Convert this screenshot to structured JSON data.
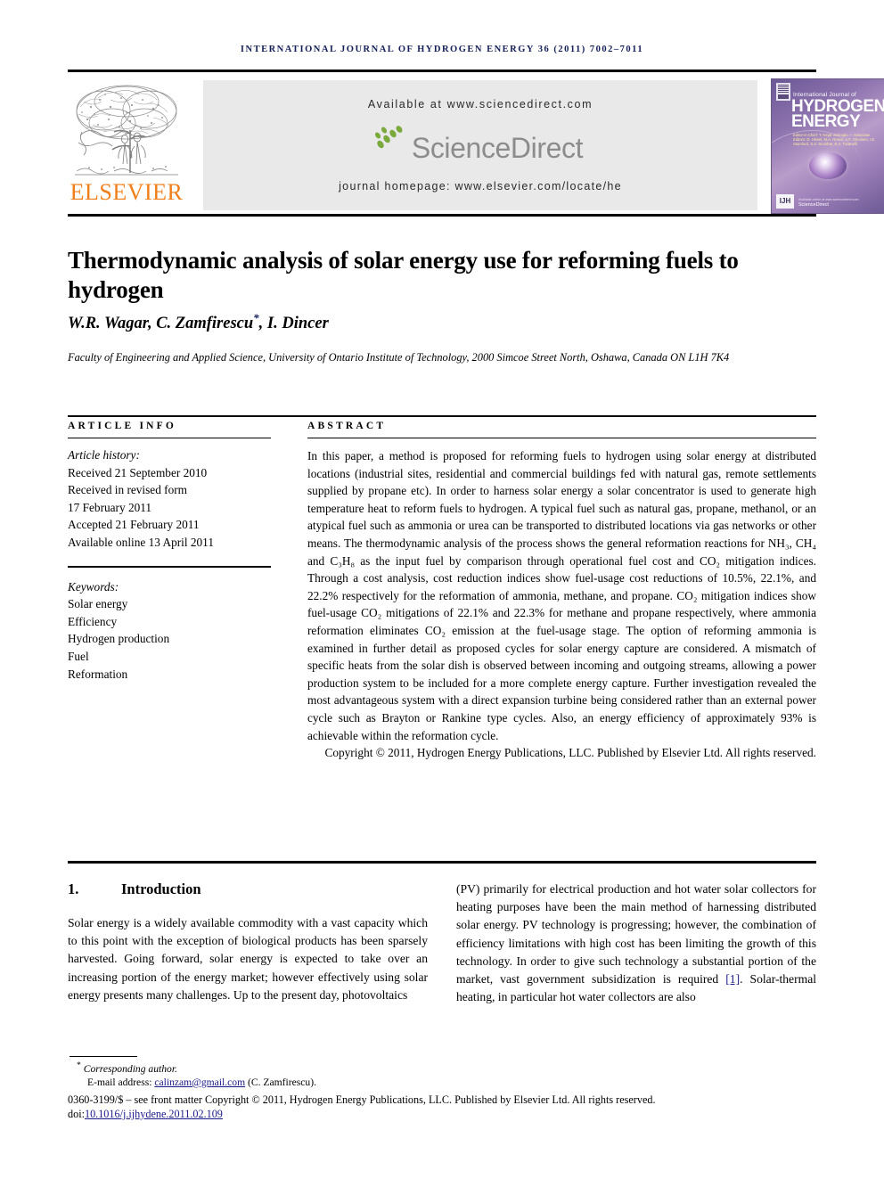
{
  "running_head": "International Journal of Hydrogen Energy 36 (2011) 7002–7011",
  "masthead": {
    "publisher_wordmark": "ELSEVIER",
    "available_line": "Available at www.sciencedirect.com",
    "sciencedirect_word": "ScienceDirect",
    "homepage_line": "journal homepage: www.elsevier.com/locate/he",
    "cover": {
      "line_small": "International Journal of",
      "title_line1": "HYDROGEN",
      "title_line2": "ENERGY",
      "editors": "Editor-in-Chief: T. Nejat Veziroglu  —  Associate Editors: D. Hissel, M.A. Rosen, A.F. Ghoniem, I.E. Stamford, S.S. Deodhar, E.A. Ticianelli",
      "badge": "IJH",
      "sciencedirect_small": "ScienceDirect",
      "sciencedirect_tiny": "Available online at www.sciencedirect.com"
    }
  },
  "article": {
    "title": "Thermodynamic analysis of solar energy use for reforming fuels to hydrogen",
    "authors": "W.R. Wagar, C. Zamfirescu",
    "authors_tail": ", I. Dincer",
    "corresponding_marker": "*",
    "affiliation": "Faculty of Engineering and Applied Science, University of Ontario Institute of Technology, 2000 Simcoe Street North, Oshawa, Canada ON L1H 7K4"
  },
  "article_info": {
    "label": "ARTICLE INFO",
    "history_label": "Article history:",
    "history": [
      "Received 21 September 2010",
      "Received in revised form",
      "17 February 2011",
      "Accepted 21 February 2011",
      "Available online 13 April 2011"
    ],
    "keywords_label": "Keywords:",
    "keywords": [
      "Solar energy",
      "Efficiency",
      "Hydrogen production",
      "Fuel",
      "Reformation"
    ]
  },
  "abstract": {
    "label": "ABSTRACT",
    "text": "In this paper, a method is proposed for reforming fuels to hydrogen using solar energy at distributed locations (industrial sites, residential and commercial buildings fed with natural gas, remote settlements supplied by propane etc). In order to harness solar energy a solar concentrator is used to generate high temperature heat to reform fuels to hydrogen. A typical fuel such as natural gas, propane, methanol, or an atypical fuel such as ammonia or urea can be transported to distributed locations via gas networks or other means. The thermodynamic analysis of the process shows the general reformation reactions for NH₃, CH₄ and C₃H₈ as the input fuel by comparison through operational fuel cost and CO₂ mitigation indices. Through a cost analysis, cost reduction indices show fuel-usage cost reductions of 10.5%, 22.1%, and 22.2% respectively for the reformation of ammonia, methane, and propane. CO₂ mitigation indices show fuel-usage CO₂ mitigations of 22.1% and 22.3% for methane and propane respectively, where ammonia reformation eliminates CO₂ emission at the fuel-usage stage. The option of reforming ammonia is examined in further detail as proposed cycles for solar energy capture are considered. A mismatch of specific heats from the solar dish is observed between incoming and outgoing streams, allowing a power production system to be included for a more complete energy capture. Further investigation revealed the most advantageous system with a direct expansion turbine being considered rather than an external power cycle such as Brayton or Rankine type cycles. Also, an energy efficiency of approximately 93% is achievable within the reformation cycle.",
    "copyright": "Copyright © 2011, Hydrogen Energy Publications, LLC. Published by Elsevier Ltd. All rights reserved."
  },
  "body": {
    "section_number": "1.",
    "section_title": "Introduction",
    "left_paragraph": "Solar energy is a widely available commodity with a vast capacity which to this point with the exception of biological products has been sparsely harvested. Going forward, solar energy is expected to take over an increasing portion of the energy market; however effectively using solar energy presents many challenges. Up to the present day, photovoltaics",
    "right_paragraph_pre": "(PV) primarily for electrical production and hot water solar collectors for heating purposes have been the main method of harnessing distributed solar energy. PV technology is progressing; however, the combination of efficiency limitations with high cost has been limiting the growth of this technology. In order to give such technology a substantial portion of the market, vast government subsidization is required ",
    "right_reference": "[1]",
    "right_paragraph_post": ". Solar-thermal heating, in particular hot water collectors are also"
  },
  "footer": {
    "corresponding": "Corresponding author.",
    "corresponding_marker": "*",
    "email_label": "E-mail address: ",
    "email": "calinzam@gmail.com",
    "email_owner": " (C. Zamfirescu).",
    "issn_line": "0360-3199/$ – see front matter Copyright © 2011, Hydrogen Energy Publications, LLC. Published by Elsevier Ltd. All rights reserved.",
    "doi_label": "doi:",
    "doi": "10.1016/j.ijhydene.2011.02.109"
  }
}
